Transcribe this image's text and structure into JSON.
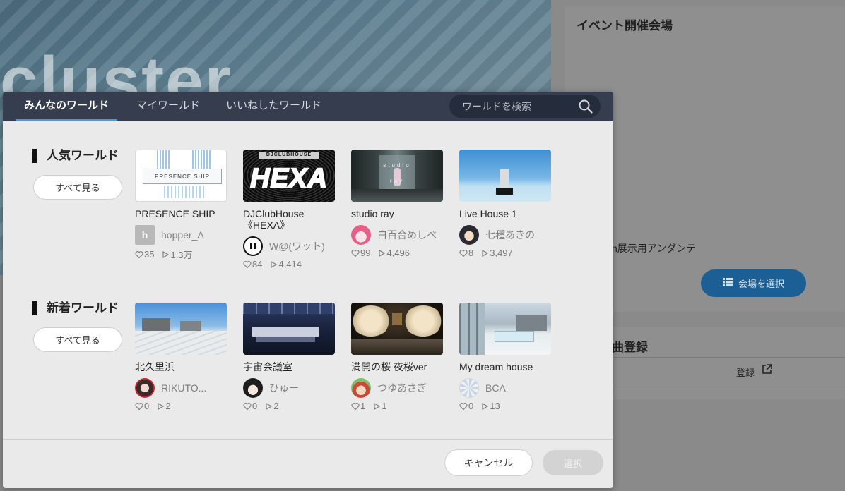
{
  "background": {
    "banner_logo": "cluster",
    "panel_title": "イベント開催会場",
    "antenna_text": "n展示用アンダンテ",
    "select_venue_button": "会場を選択",
    "panel2_title": "曲登録",
    "register_link": "登録"
  },
  "modal": {
    "tabs": [
      {
        "label": "みんなのワールド",
        "active": true
      },
      {
        "label": "マイワールド",
        "active": false
      },
      {
        "label": "いいねしたワールド",
        "active": false
      }
    ],
    "search": {
      "placeholder": "ワールドを検索"
    },
    "sections": [
      {
        "title": "人気ワールド",
        "see_all": "すべて見る",
        "worlds": [
          {
            "name": "PRESENCE SHIP",
            "author": "hopper_A",
            "likes": "35",
            "views": "1.3万"
          },
          {
            "name": "DJClubHouse 《HEXA》",
            "author": "W@(ワット)",
            "likes": "84",
            "views": "4,414"
          },
          {
            "name": "studio ray",
            "author": "白百合めしべ",
            "likes": "99",
            "views": "4,496"
          },
          {
            "name": "Live House 1",
            "author": "七種あきの",
            "likes": "8",
            "views": "3,497"
          }
        ]
      },
      {
        "title": "新着ワールド",
        "see_all": "すべて見る",
        "worlds": [
          {
            "name": "北久里浜",
            "author": "RIKUTO...",
            "likes": "0",
            "views": "2"
          },
          {
            "name": "宇宙会議室",
            "author": "ひゅー",
            "likes": "0",
            "views": "2"
          },
          {
            "name": "満開の桜 夜桜ver",
            "author": "つゆあさぎ",
            "likes": "1",
            "views": "1"
          },
          {
            "name": "My dream house",
            "author": "BCA",
            "likes": "0",
            "views": "13"
          }
        ]
      }
    ],
    "thumb_text": {
      "presence_ship": "PRESENCE  SHIP",
      "hexa_banner": "DJCLUBHOUSE",
      "hexa_logo": "HEXA",
      "studio_ray_top": "studio",
      "studio_ray_bottom": "ray"
    },
    "avatar_letters": {
      "hopper": "h"
    },
    "cancel_label": "キャンセル",
    "select_label": "選択"
  },
  "colors": {
    "header_bg": "#353d4f",
    "tab_indicator": "#4d97d6",
    "modal_bg": "#eaeaeb",
    "venue_button": "#1b5f94"
  }
}
